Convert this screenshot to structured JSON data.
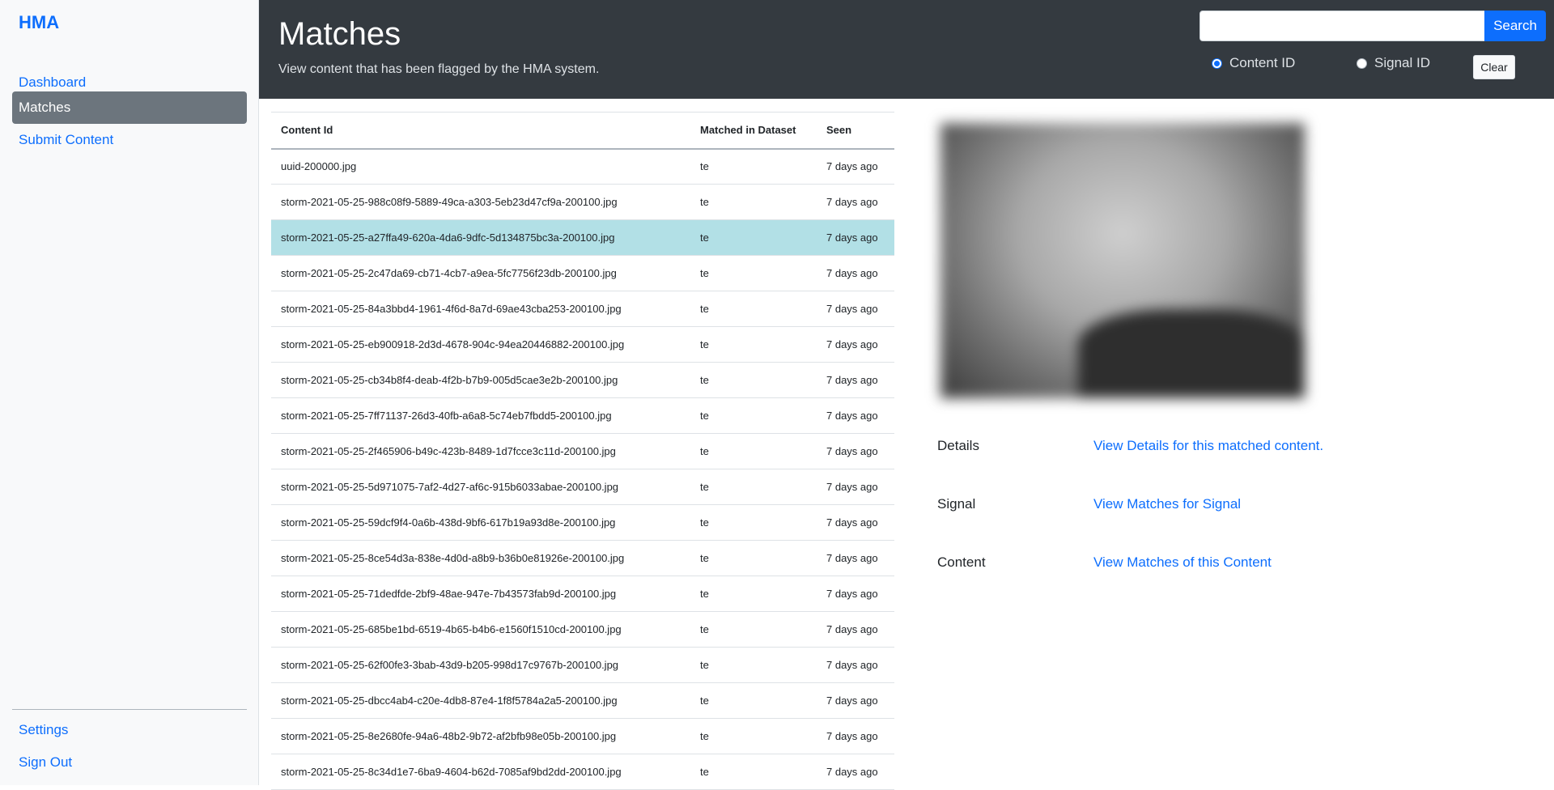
{
  "sidebar": {
    "brand": "HMA",
    "items": [
      {
        "label": "Dashboard"
      },
      {
        "label": "Matches"
      },
      {
        "label": "Submit Content"
      }
    ],
    "bottom_items": [
      {
        "label": "Settings"
      },
      {
        "label": "Sign Out"
      }
    ]
  },
  "header": {
    "title": "Matches",
    "subtitle": "View content that has been flagged by the HMA system.",
    "search": {
      "value": "",
      "button_label": "Search"
    },
    "radio_options": [
      {
        "label": "Content ID",
        "checked": true
      },
      {
        "label": "Signal ID",
        "checked": false
      }
    ],
    "clear_label": "Clear"
  },
  "table": {
    "columns": [
      "Content Id",
      "Matched in Dataset",
      "Seen"
    ],
    "rows": [
      {
        "content_id": "uuid-200000.jpg",
        "dataset": "te",
        "seen": "7 days ago"
      },
      {
        "content_id": "storm-2021-05-25-988c08f9-5889-49ca-a303-5eb23d47cf9a-200100.jpg",
        "dataset": "te",
        "seen": "7 days ago"
      },
      {
        "content_id": "storm-2021-05-25-a27ffa49-620a-4da6-9dfc-5d134875bc3a-200100.jpg",
        "dataset": "te",
        "seen": "7 days ago"
      },
      {
        "content_id": "storm-2021-05-25-2c47da69-cb71-4cb7-a9ea-5fc7756f23db-200100.jpg",
        "dataset": "te",
        "seen": "7 days ago"
      },
      {
        "content_id": "storm-2021-05-25-84a3bbd4-1961-4f6d-8a7d-69ae43cba253-200100.jpg",
        "dataset": "te",
        "seen": "7 days ago"
      },
      {
        "content_id": "storm-2021-05-25-eb900918-2d3d-4678-904c-94ea20446882-200100.jpg",
        "dataset": "te",
        "seen": "7 days ago"
      },
      {
        "content_id": "storm-2021-05-25-cb34b8f4-deab-4f2b-b7b9-005d5cae3e2b-200100.jpg",
        "dataset": "te",
        "seen": "7 days ago"
      },
      {
        "content_id": "storm-2021-05-25-7ff71137-26d3-40fb-a6a8-5c74eb7fbdd5-200100.jpg",
        "dataset": "te",
        "seen": "7 days ago"
      },
      {
        "content_id": "storm-2021-05-25-2f465906-b49c-423b-8489-1d7fcce3c11d-200100.jpg",
        "dataset": "te",
        "seen": "7 days ago"
      },
      {
        "content_id": "storm-2021-05-25-5d971075-7af2-4d27-af6c-915b6033abae-200100.jpg",
        "dataset": "te",
        "seen": "7 days ago"
      },
      {
        "content_id": "storm-2021-05-25-59dcf9f4-0a6b-438d-9bf6-617b19a93d8e-200100.jpg",
        "dataset": "te",
        "seen": "7 days ago"
      },
      {
        "content_id": "storm-2021-05-25-8ce54d3a-838e-4d0d-a8b9-b36b0e81926e-200100.jpg",
        "dataset": "te",
        "seen": "7 days ago"
      },
      {
        "content_id": "storm-2021-05-25-71dedfde-2bf9-48ae-947e-7b43573fab9d-200100.jpg",
        "dataset": "te",
        "seen": "7 days ago"
      },
      {
        "content_id": "storm-2021-05-25-685be1bd-6519-4b65-b4b6-e1560f1510cd-200100.jpg",
        "dataset": "te",
        "seen": "7 days ago"
      },
      {
        "content_id": "storm-2021-05-25-62f00fe3-3bab-43d9-b205-998d17c9767b-200100.jpg",
        "dataset": "te",
        "seen": "7 days ago"
      },
      {
        "content_id": "storm-2021-05-25-dbcc4ab4-c20e-4db8-87e4-1f8f5784a2a5-200100.jpg",
        "dataset": "te",
        "seen": "7 days ago"
      },
      {
        "content_id": "storm-2021-05-25-8e2680fe-94a6-48b2-9b72-af2bfb98e05b-200100.jpg",
        "dataset": "te",
        "seen": "7 days ago"
      },
      {
        "content_id": "storm-2021-05-25-8c34d1e7-6ba9-4604-b62d-7085af9bd2dd-200100.jpg",
        "dataset": "te",
        "seen": "7 days ago"
      }
    ],
    "selected_index": 2
  },
  "detail": {
    "rows": [
      {
        "label": "Details",
        "link": "View Details for this matched content."
      },
      {
        "label": "Signal",
        "link": "View Matches for Signal"
      },
      {
        "label": "Content",
        "link": "View Matches of this Content"
      }
    ]
  },
  "colors": {
    "accent": "#0d6efd",
    "header_bg": "#343a40",
    "sidebar_bg": "#f8f9fa",
    "selected_row": "#b2e0e6"
  }
}
